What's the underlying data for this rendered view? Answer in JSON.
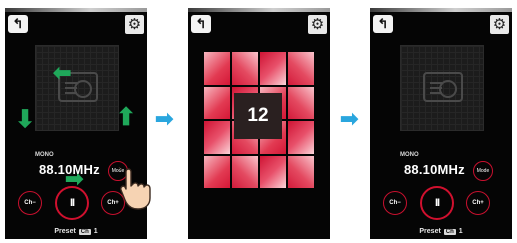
{
  "screens": [
    {
      "back_icon": "back-icon",
      "settings_icon": "gear-icon",
      "mono_label": "MONO",
      "frequency": "88.10MHz",
      "mode_label": "Mode",
      "ch_minus_label": "Ch−",
      "pause_label": "II",
      "ch_plus_label": "Ch+",
      "preset_label": "Preset",
      "preset_badge": "Ch",
      "preset_number": "1"
    },
    {
      "back_icon": "back-icon",
      "settings_icon": "gear-icon",
      "overlay_number": "12"
    },
    {
      "back_icon": "back-icon",
      "settings_icon": "gear-icon",
      "mono_label": "MONO",
      "frequency": "88.10MHz",
      "mode_label": "Mode",
      "ch_minus_label": "Ch−",
      "pause_label": "II",
      "ch_plus_label": "Ch+",
      "preset_label": "Preset",
      "preset_badge": "Ch",
      "preset_number": "1"
    }
  ],
  "colors": {
    "accent_red": "#c8102e",
    "arrow_green": "#1fa85a",
    "arrow_blue": "#2aa6de"
  }
}
